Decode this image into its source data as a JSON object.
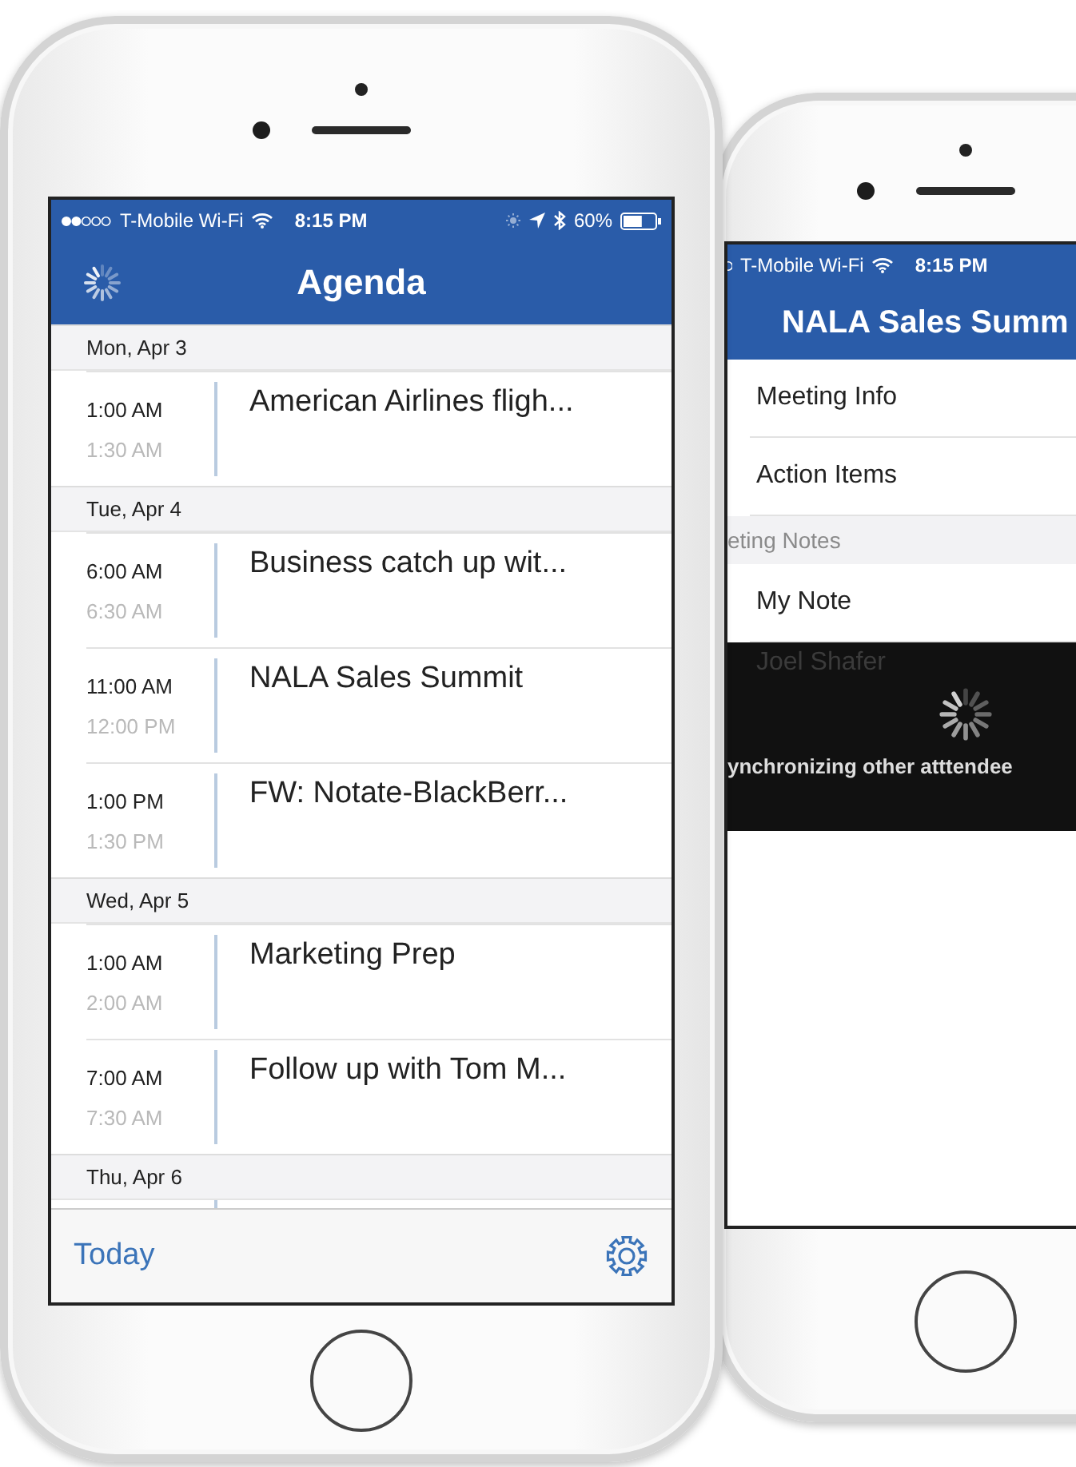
{
  "agenda_phone": {
    "status_bar": {
      "carrier": "T-Mobile Wi-Fi",
      "time": "8:15 PM",
      "battery": {
        "reading": "60%",
        "level": 0.6
      }
    },
    "title": "Agenda",
    "days": [
      {
        "date": "Mon, Apr 3",
        "events": [
          {
            "start": "1:00 AM",
            "end": "1:30 AM",
            "title": "American Airlines fligh..."
          }
        ]
      },
      {
        "date": "Tue, Apr 4",
        "events": [
          {
            "start": "6:00 AM",
            "end": "6:30 AM",
            "title": "Business catch up wit..."
          },
          {
            "start": "11:00 AM",
            "end": "12:00 PM",
            "title": "NALA Sales Summit"
          },
          {
            "start": "1:00 PM",
            "end": "1:30 PM",
            "title": "FW: Notate-BlackBerr..."
          }
        ]
      },
      {
        "date": "Wed, Apr 5",
        "events": [
          {
            "start": "1:00 AM",
            "end": "2:00 AM",
            "title": "Marketing Prep"
          },
          {
            "start": "7:00 AM",
            "end": "7:30 AM",
            "title": "Follow up with Tom M..."
          }
        ]
      },
      {
        "date": "Thu, Apr 6"
      }
    ],
    "footer": {
      "link": "Today"
    }
  },
  "meeting_phone": {
    "status_bar": {
      "carrier": "T-Mobile Wi-Fi",
      "time": "8:15 PM"
    },
    "title": "NALA Sales Summ",
    "items": [
      {
        "kind": "row",
        "label": "Meeting Info"
      },
      {
        "kind": "row",
        "label": "Action Items"
      },
      {
        "kind": "section",
        "label": "eting Notes"
      },
      {
        "kind": "row",
        "label": "My Note"
      }
    ],
    "overlay": {
      "covered_row": "Joel Shafer",
      "message": "ynchronizing other atttendee"
    }
  }
}
